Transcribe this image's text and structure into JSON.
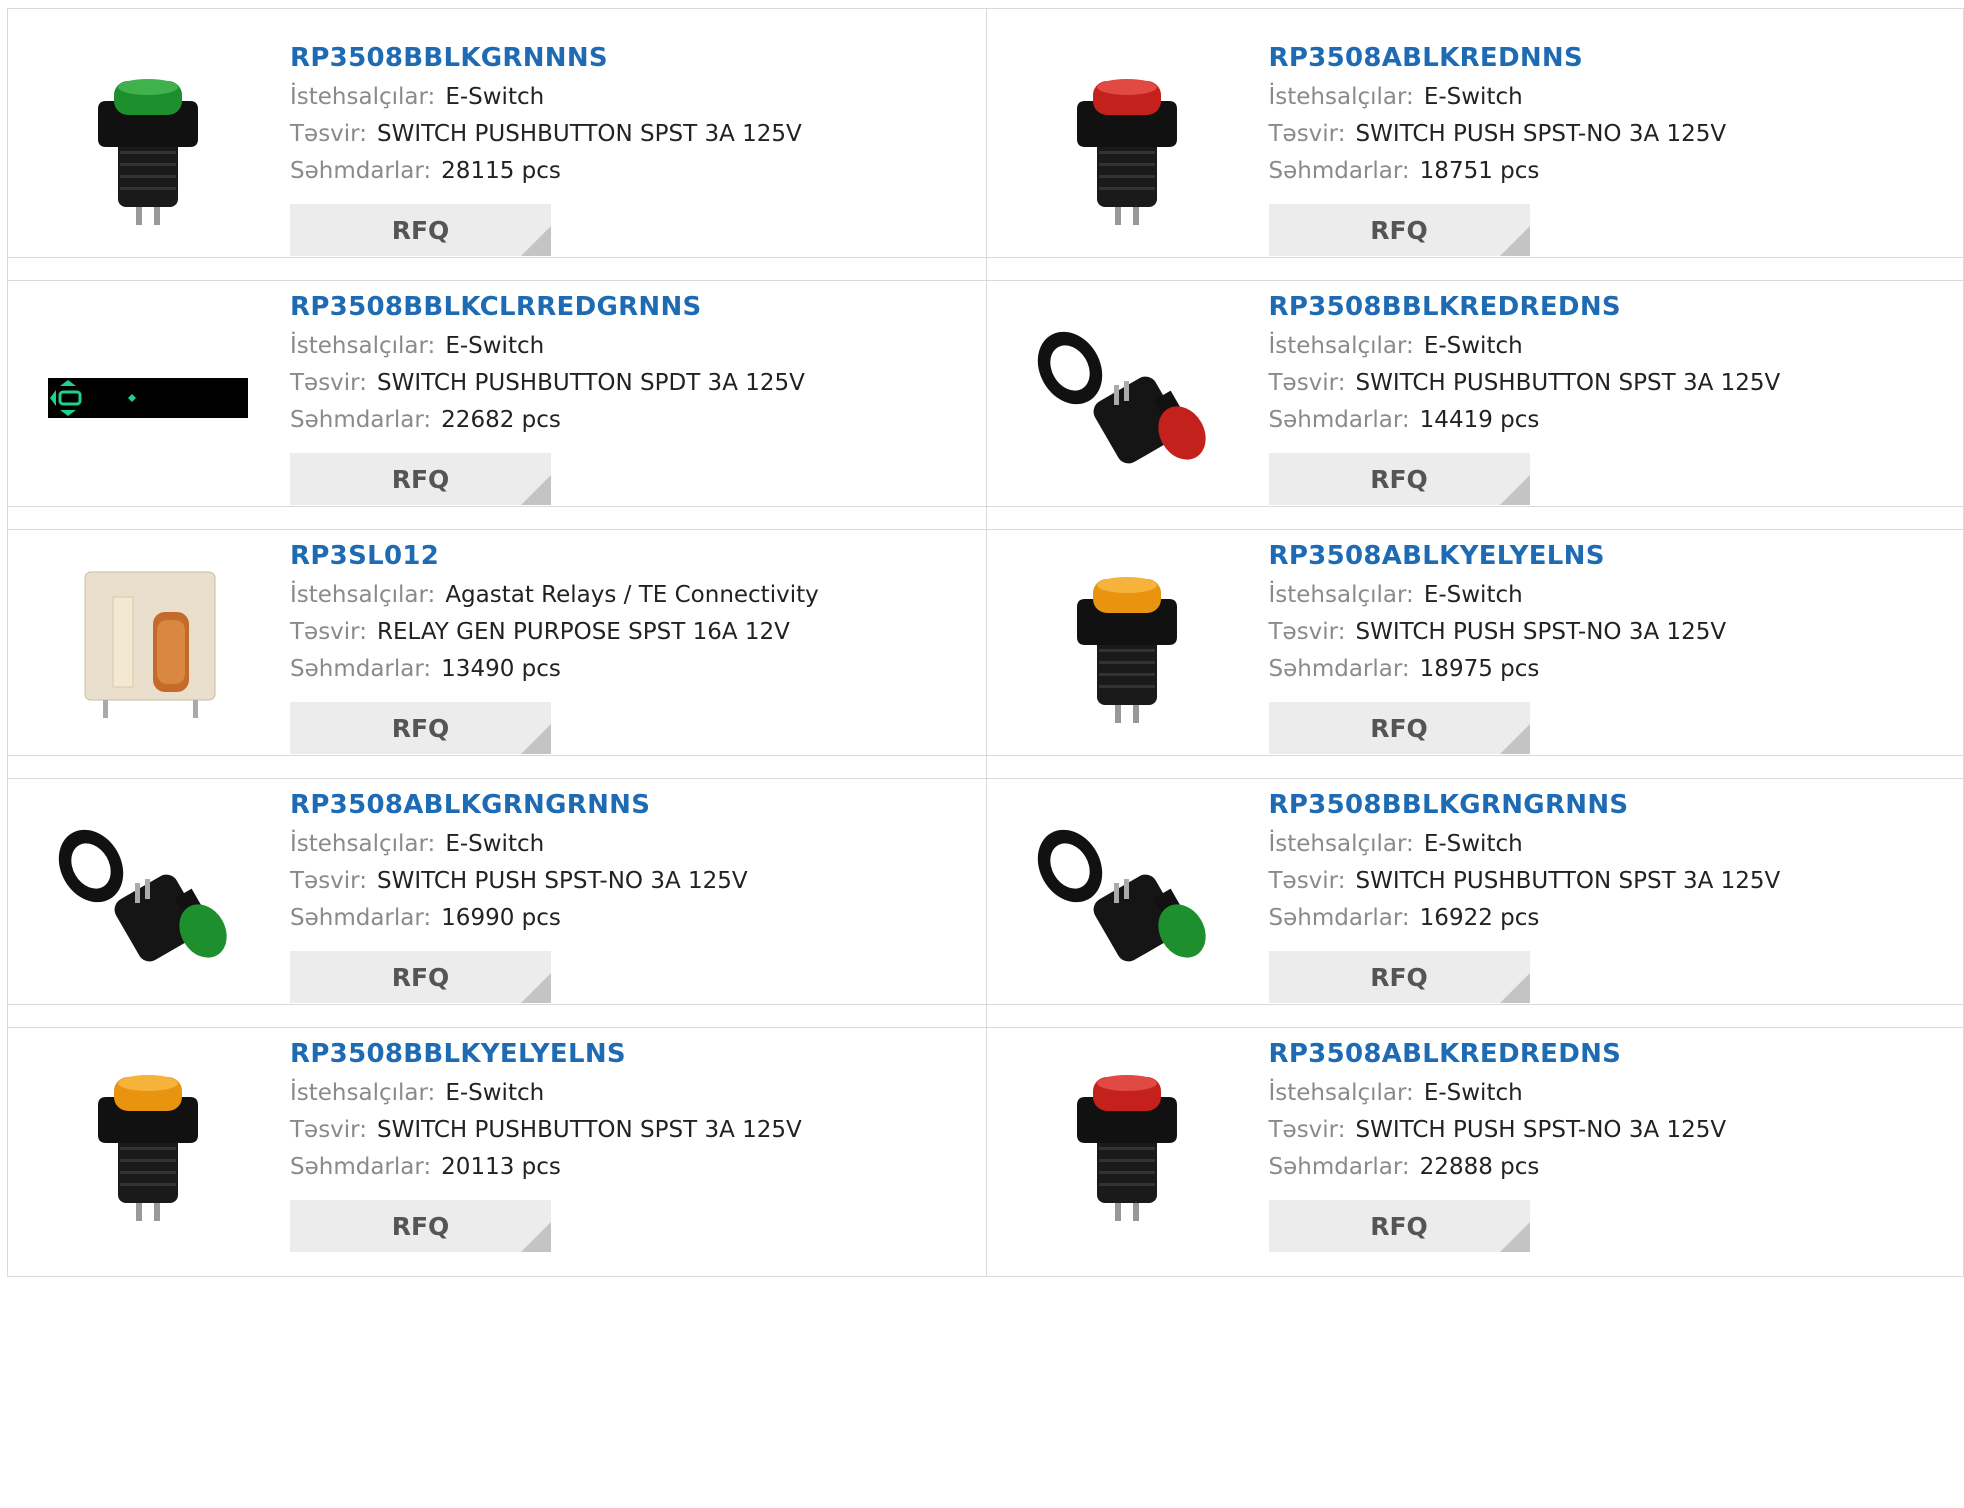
{
  "labels": {
    "manufacturer": "İstehsalçılar:",
    "description": "Təsvir:",
    "stock": "Səhmdarlar:",
    "rfq": "RFQ"
  },
  "colors": {
    "title_link": "#1e6bb3",
    "label_gray": "#8a8a8a",
    "button_bg": "#ececec",
    "button_corner": "#c4c4c4",
    "border": "#d9d9d9"
  },
  "products": [
    {
      "part": "RP3508BBLKGRNNNS",
      "manufacturer": "E-Switch",
      "description": "SWITCH PUSHBUTTON SPST 3A 125V",
      "stock": "28115 pcs",
      "image": "green-pushbutton-switch"
    },
    {
      "part": "RP3508ABLKREDNNS",
      "manufacturer": "E-Switch",
      "description": "SWITCH PUSH SPST-NO 3A 125V",
      "stock": "18751 pcs",
      "image": "red-pushbutton-switch"
    },
    {
      "part": "RP3508BBLKCLRREDGRNNS",
      "manufacturer": "E-Switch",
      "description": "SWITCH PUSHBUTTON SPDT 3A 125V",
      "stock": "22682 pcs",
      "image": "placeholder-banner"
    },
    {
      "part": "RP3508BBLKREDREDNS",
      "manufacturer": "E-Switch",
      "description": "SWITCH PUSHBUTTON SPST 3A 125V",
      "stock": "14419 pcs",
      "image": "red-pushbutton-with-bezel"
    },
    {
      "part": "RP3SL012",
      "manufacturer": "Agastat Relays / TE Connectivity",
      "description": "RELAY GEN PURPOSE SPST 16A 12V",
      "stock": "13490 pcs",
      "image": "relay"
    },
    {
      "part": "RP3508ABLKYELYELNS",
      "manufacturer": "E-Switch",
      "description": "SWITCH PUSH SPST-NO 3A 125V",
      "stock": "18975 pcs",
      "image": "yellow-pushbutton-switch"
    },
    {
      "part": "RP3508ABLKGRNGRNNS",
      "manufacturer": "E-Switch",
      "description": "SWITCH PUSH SPST-NO 3A 125V",
      "stock": "16990 pcs",
      "image": "green-pushbutton-with-bezel"
    },
    {
      "part": "RP3508BBLKGRNGRNNS",
      "manufacturer": "E-Switch",
      "description": "SWITCH PUSHBUTTON SPST 3A 125V",
      "stock": "16922 pcs",
      "image": "green-pushbutton-with-ring"
    },
    {
      "part": "RP3508BBLKYELYELNS",
      "manufacturer": "E-Switch",
      "description": "SWITCH PUSHBUTTON SPST 3A 125V",
      "stock": "20113 pcs",
      "image": "yellow-pushbutton-switch"
    },
    {
      "part": "RP3508ABLKREDREDNS",
      "manufacturer": "E-Switch",
      "description": "SWITCH PUSH SPST-NO 3A 125V",
      "stock": "22888 pcs",
      "image": "red-pushbutton-switch"
    }
  ]
}
